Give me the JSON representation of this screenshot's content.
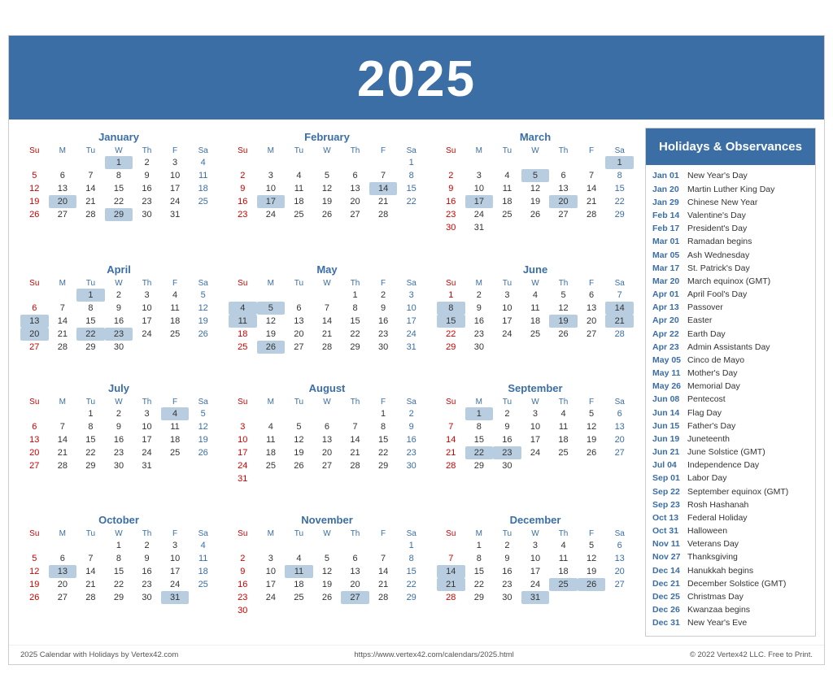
{
  "header": {
    "year": "2025"
  },
  "months": [
    {
      "name": "January",
      "startDay": 3,
      "days": 31,
      "highlighted": [
        1,
        20,
        29
      ],
      "weeks": [
        [
          null,
          null,
          null,
          1,
          2,
          3,
          4
        ],
        [
          5,
          6,
          7,
          8,
          9,
          10,
          11
        ],
        [
          12,
          13,
          14,
          15,
          16,
          17,
          18
        ],
        [
          19,
          20,
          21,
          22,
          23,
          24,
          25
        ],
        [
          26,
          27,
          28,
          29,
          30,
          31,
          null
        ]
      ]
    },
    {
      "name": "February",
      "startDay": 6,
      "days": 28,
      "highlighted": [
        14,
        17
      ],
      "weeks": [
        [
          null,
          null,
          null,
          null,
          null,
          null,
          1
        ],
        [
          2,
          3,
          4,
          5,
          6,
          7,
          8
        ],
        [
          9,
          10,
          11,
          12,
          13,
          14,
          15
        ],
        [
          16,
          17,
          18,
          19,
          20,
          21,
          22
        ],
        [
          23,
          24,
          25,
          26,
          27,
          28,
          null
        ]
      ]
    },
    {
      "name": "March",
      "startDay": 6,
      "days": 31,
      "highlighted": [
        1,
        5,
        17,
        20
      ],
      "weeks": [
        [
          null,
          null,
          null,
          null,
          null,
          null,
          1
        ],
        [
          2,
          3,
          4,
          5,
          6,
          7,
          8
        ],
        [
          9,
          10,
          11,
          12,
          13,
          14,
          15
        ],
        [
          16,
          17,
          18,
          19,
          20,
          21,
          22
        ],
        [
          23,
          24,
          25,
          26,
          27,
          28,
          29
        ],
        [
          30,
          31,
          null,
          null,
          null,
          null,
          null
        ]
      ]
    },
    {
      "name": "April",
      "startDay": 2,
      "days": 30,
      "highlighted": [
        1,
        13,
        20,
        22,
        23
      ],
      "weeks": [
        [
          null,
          null,
          1,
          2,
          3,
          4,
          5
        ],
        [
          6,
          7,
          8,
          9,
          10,
          11,
          12
        ],
        [
          13,
          14,
          15,
          16,
          17,
          18,
          19
        ],
        [
          20,
          21,
          22,
          23,
          24,
          25,
          26
        ],
        [
          27,
          28,
          29,
          30,
          null,
          null,
          null
        ]
      ]
    },
    {
      "name": "May",
      "startDay": 4,
      "days": 31,
      "highlighted": [
        4,
        5,
        11,
        26
      ],
      "weeks": [
        [
          null,
          null,
          null,
          null,
          1,
          2,
          3
        ],
        [
          4,
          5,
          6,
          7,
          8,
          9,
          10
        ],
        [
          11,
          12,
          13,
          14,
          15,
          16,
          17
        ],
        [
          18,
          19,
          20,
          21,
          22,
          23,
          24
        ],
        [
          25,
          26,
          27,
          28,
          29,
          30,
          31
        ]
      ]
    },
    {
      "name": "June",
      "startDay": 0,
      "days": 30,
      "highlighted": [
        8,
        14,
        15,
        19,
        21
      ],
      "weeks": [
        [
          1,
          2,
          3,
          4,
          5,
          6,
          7
        ],
        [
          8,
          9,
          10,
          11,
          12,
          13,
          14
        ],
        [
          15,
          16,
          17,
          18,
          19,
          20,
          21
        ],
        [
          22,
          23,
          24,
          25,
          26,
          27,
          28
        ],
        [
          29,
          30,
          null,
          null,
          null,
          null,
          null
        ]
      ]
    },
    {
      "name": "July",
      "startDay": 2,
      "days": 31,
      "highlighted": [
        4
      ],
      "weeks": [
        [
          null,
          null,
          1,
          2,
          3,
          4,
          5
        ],
        [
          6,
          7,
          8,
          9,
          10,
          11,
          12
        ],
        [
          13,
          14,
          15,
          16,
          17,
          18,
          19
        ],
        [
          20,
          21,
          22,
          23,
          24,
          25,
          26
        ],
        [
          27,
          28,
          29,
          30,
          31,
          null,
          null
        ]
      ]
    },
    {
      "name": "August",
      "startDay": 5,
      "days": 31,
      "highlighted": [],
      "weeks": [
        [
          null,
          null,
          null,
          null,
          null,
          1,
          2
        ],
        [
          3,
          4,
          5,
          6,
          7,
          8,
          9
        ],
        [
          10,
          11,
          12,
          13,
          14,
          15,
          16
        ],
        [
          17,
          18,
          19,
          20,
          21,
          22,
          23
        ],
        [
          24,
          25,
          26,
          27,
          28,
          29,
          30
        ],
        [
          31,
          null,
          null,
          null,
          null,
          null,
          null
        ]
      ]
    },
    {
      "name": "September",
      "startDay": 1,
      "days": 30,
      "highlighted": [
        1,
        22,
        23
      ],
      "weeks": [
        [
          null,
          1,
          2,
          3,
          4,
          5,
          6
        ],
        [
          7,
          8,
          9,
          10,
          11,
          12,
          13
        ],
        [
          14,
          15,
          16,
          17,
          18,
          19,
          20
        ],
        [
          21,
          22,
          23,
          24,
          25,
          26,
          27
        ],
        [
          28,
          29,
          30,
          null,
          null,
          null,
          null
        ]
      ]
    },
    {
      "name": "October",
      "startDay": 3,
      "days": 31,
      "highlighted": [
        13,
        31
      ],
      "weeks": [
        [
          null,
          null,
          null,
          1,
          2,
          3,
          4
        ],
        [
          5,
          6,
          7,
          8,
          9,
          10,
          11
        ],
        [
          12,
          13,
          14,
          15,
          16,
          17,
          18
        ],
        [
          19,
          20,
          21,
          22,
          23,
          24,
          25
        ],
        [
          26,
          27,
          28,
          29,
          30,
          31,
          null
        ]
      ]
    },
    {
      "name": "November",
      "startDay": 6,
      "days": 30,
      "highlighted": [
        11,
        27
      ],
      "weeks": [
        [
          null,
          null,
          null,
          null,
          null,
          null,
          1
        ],
        [
          2,
          3,
          4,
          5,
          6,
          7,
          8
        ],
        [
          9,
          10,
          11,
          12,
          13,
          14,
          15
        ],
        [
          16,
          17,
          18,
          19,
          20,
          21,
          22
        ],
        [
          23,
          24,
          25,
          26,
          27,
          28,
          29
        ],
        [
          30,
          null,
          null,
          null,
          null,
          null,
          null
        ]
      ]
    },
    {
      "name": "December",
      "startDay": 1,
      "days": 31,
      "highlighted": [
        14,
        21,
        25,
        26
      ],
      "weeks": [
        [
          null,
          1,
          2,
          3,
          4,
          5,
          6
        ],
        [
          7,
          8,
          9,
          10,
          11,
          12,
          13
        ],
        [
          14,
          15,
          16,
          17,
          18,
          19,
          20
        ],
        [
          21,
          22,
          23,
          24,
          25,
          26,
          27
        ],
        [
          28,
          29,
          30,
          31,
          null,
          null,
          null
        ]
      ]
    }
  ],
  "holidays_header": "Holidays &\nObservances",
  "holidays": [
    {
      "date": "Jan 01",
      "name": "New Year's Day"
    },
    {
      "date": "Jan 20",
      "name": "Martin Luther King Day"
    },
    {
      "date": "Jan 29",
      "name": "Chinese New Year"
    },
    {
      "date": "Feb 14",
      "name": "Valentine's Day"
    },
    {
      "date": "Feb 17",
      "name": "President's Day"
    },
    {
      "date": "Mar 01",
      "name": "Ramadan begins"
    },
    {
      "date": "Mar 05",
      "name": "Ash Wednesday"
    },
    {
      "date": "Mar 17",
      "name": "St. Patrick's Day"
    },
    {
      "date": "Mar 20",
      "name": "March equinox (GMT)"
    },
    {
      "date": "Apr 01",
      "name": "April Fool's Day"
    },
    {
      "date": "Apr 13",
      "name": "Passover"
    },
    {
      "date": "Apr 20",
      "name": "Easter"
    },
    {
      "date": "Apr 22",
      "name": "Earth Day"
    },
    {
      "date": "Apr 23",
      "name": "Admin Assistants Day"
    },
    {
      "date": "May 05",
      "name": "Cinco de Mayo"
    },
    {
      "date": "May 11",
      "name": "Mother's Day"
    },
    {
      "date": "May 26",
      "name": "Memorial Day"
    },
    {
      "date": "Jun 08",
      "name": "Pentecost"
    },
    {
      "date": "Jun 14",
      "name": "Flag Day"
    },
    {
      "date": "Jun 15",
      "name": "Father's Day"
    },
    {
      "date": "Jun 19",
      "name": "Juneteenth"
    },
    {
      "date": "Jun 21",
      "name": "June Solstice (GMT)"
    },
    {
      "date": "Jul 04",
      "name": "Independence Day"
    },
    {
      "date": "Sep 01",
      "name": "Labor Day"
    },
    {
      "date": "Sep 22",
      "name": "September equinox (GMT)"
    },
    {
      "date": "Sep 23",
      "name": "Rosh Hashanah"
    },
    {
      "date": "Oct 13",
      "name": "Federal Holiday"
    },
    {
      "date": "Oct 31",
      "name": "Halloween"
    },
    {
      "date": "Nov 11",
      "name": "Veterans Day"
    },
    {
      "date": "Nov 27",
      "name": "Thanksgiving"
    },
    {
      "date": "Dec 14",
      "name": "Hanukkah begins"
    },
    {
      "date": "Dec 21",
      "name": "December Solstice (GMT)"
    },
    {
      "date": "Dec 25",
      "name": "Christmas Day"
    },
    {
      "date": "Dec 26",
      "name": "Kwanzaa begins"
    },
    {
      "date": "Dec 31",
      "name": "New Year's Eve"
    }
  ],
  "footer": {
    "left": "2025 Calendar with Holidays by Vertex42.com",
    "center": "https://www.vertex42.com/calendars/2025.html",
    "right": "© 2022 Vertex42 LLC. Free to Print."
  },
  "day_headers": [
    "Su",
    "M",
    "Tu",
    "W",
    "Th",
    "F",
    "Sa"
  ]
}
